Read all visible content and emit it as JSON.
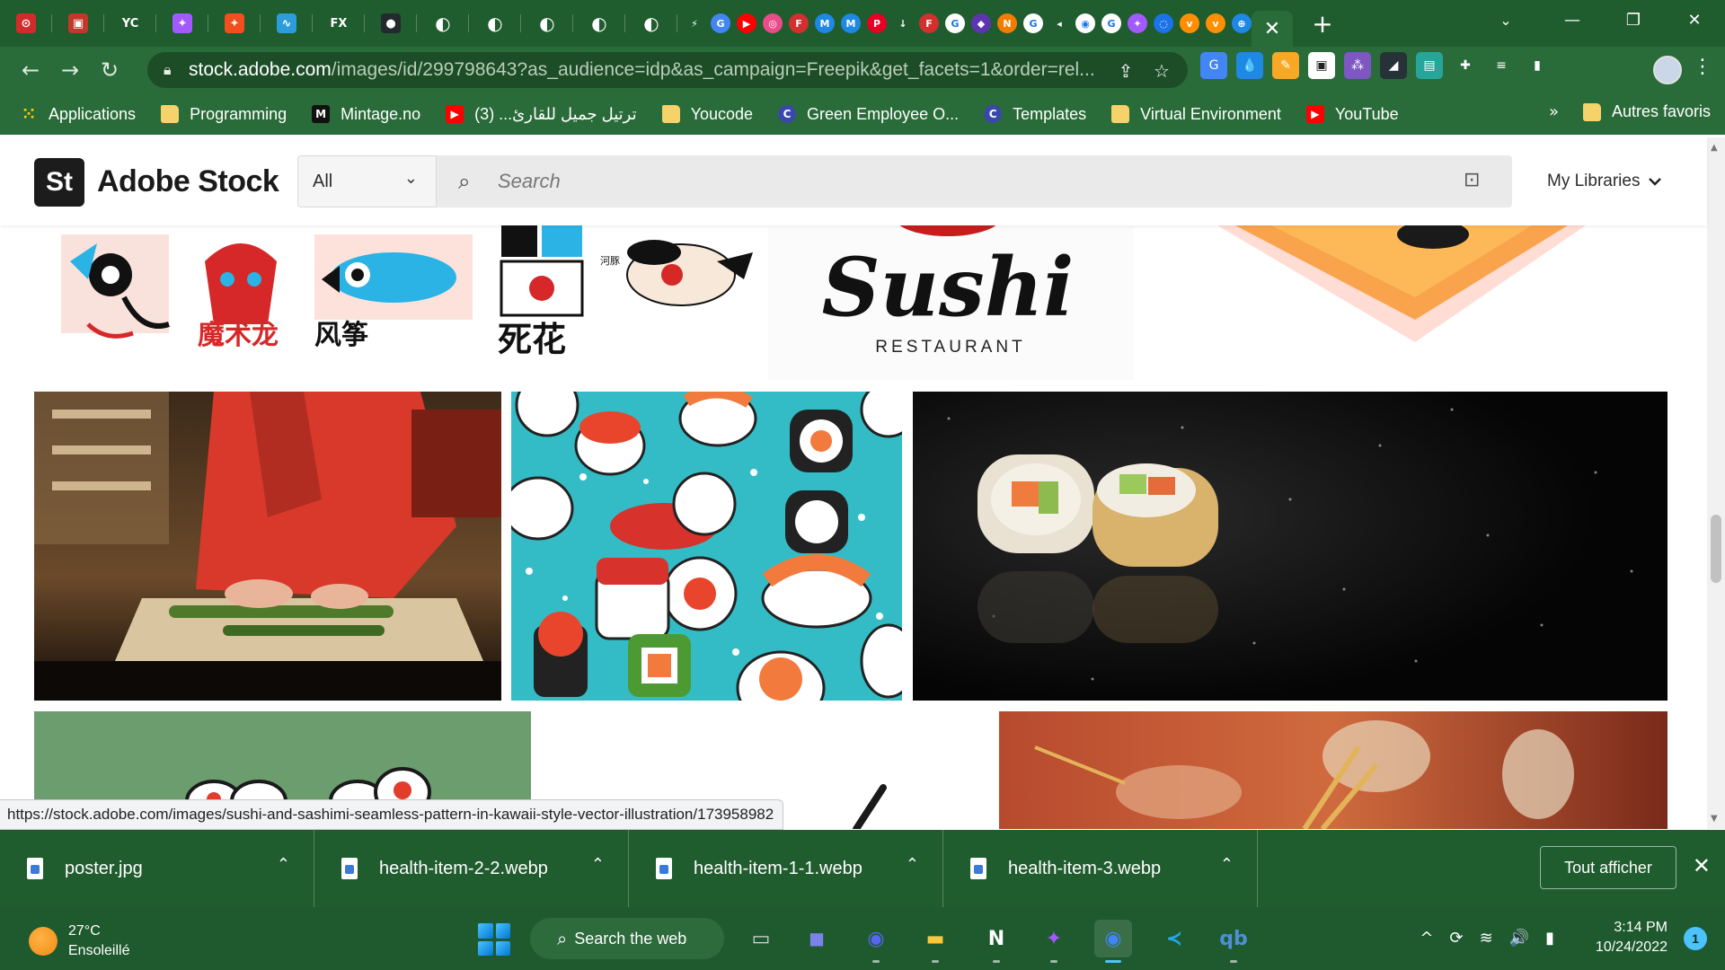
{
  "browser": {
    "pinned_tabs": [
      {
        "icon": "opera-icon",
        "color": "#d32b2b",
        "glyph": "⊙"
      },
      {
        "icon": "chrome-ext-icon",
        "color": "#c0392b",
        "glyph": "▣"
      },
      {
        "icon": "yc-icon",
        "color": "#1f5c2e",
        "glyph": "YC"
      },
      {
        "icon": "figma-icon",
        "color": "#a259ff",
        "glyph": "✦"
      },
      {
        "icon": "figma-icon",
        "color": "#f24e1e",
        "glyph": "✦"
      },
      {
        "icon": "notion-sync-icon",
        "color": "#2d9cdb",
        "glyph": "∿"
      },
      {
        "icon": "fx-icon",
        "color": "#1f5c2e",
        "glyph": "FX"
      },
      {
        "icon": "github-icon",
        "color": "#24292e",
        "glyph": "●"
      },
      {
        "icon": "site-icon",
        "color": "#ffffff",
        "glyph": "◐"
      },
      {
        "icon": "site-icon",
        "color": "#ffffff",
        "glyph": "◐"
      },
      {
        "icon": "site-icon",
        "color": "#ffffff",
        "glyph": "◐"
      },
      {
        "icon": "site-icon",
        "color": "#ffffff",
        "glyph": "◐"
      },
      {
        "icon": "site-icon",
        "color": "#ffffff",
        "glyph": "◐"
      }
    ],
    "mini_tabs": [
      {
        "icon": "lightning-icon",
        "color": "#1f5c2e",
        "glyph": "⚡"
      },
      {
        "icon": "translate-icon",
        "color": "#4285f4",
        "glyph": "G"
      },
      {
        "icon": "youtube-icon",
        "color": "#ff0000",
        "glyph": "▶"
      },
      {
        "icon": "dribbble-icon",
        "color": "#ea4c89",
        "glyph": "◎"
      },
      {
        "icon": "f-icon",
        "color": "#d32f2f",
        "glyph": "F"
      },
      {
        "icon": "mw-icon",
        "color": "#1e88e5",
        "glyph": "M"
      },
      {
        "icon": "mw-icon",
        "color": "#1e88e5",
        "glyph": "M"
      },
      {
        "icon": "pinterest-icon",
        "color": "#e60023",
        "glyph": "P"
      },
      {
        "icon": "download-icon",
        "color": "#1f5c2e",
        "glyph": "↓"
      },
      {
        "icon": "f-icon",
        "color": "#d32f2f",
        "glyph": "F"
      },
      {
        "icon": "google-icon",
        "color": "#ffffff",
        "glyph": "G"
      },
      {
        "icon": "gem-icon",
        "color": "#5e35b1",
        "glyph": "◆"
      },
      {
        "icon": "nx-icon",
        "color": "#f57c00",
        "glyph": "N"
      },
      {
        "icon": "google-icon",
        "color": "#ffffff",
        "glyph": "G"
      },
      {
        "icon": "sound-icon",
        "color": "#1f5c2e",
        "glyph": "◂"
      },
      {
        "icon": "chrome-icon",
        "color": "#ffffff",
        "glyph": "◉"
      },
      {
        "icon": "google-icon",
        "color": "#ffffff",
        "glyph": "G"
      },
      {
        "icon": "figma-icon",
        "color": "#a259ff",
        "glyph": "✦"
      },
      {
        "icon": "ring-icon",
        "color": "#1a73e8",
        "glyph": "◌"
      },
      {
        "icon": "v-icon",
        "color": "#ff8f00",
        "glyph": "v"
      },
      {
        "icon": "v-icon",
        "color": "#ff8f00",
        "glyph": "v"
      },
      {
        "icon": "globe-icon",
        "color": "#1e88e5",
        "glyph": "⊕"
      }
    ],
    "active_tab_close": "✕",
    "new_tab": "+",
    "tab_search": "⌄",
    "window": {
      "minimize": "—",
      "restore": "❐",
      "close": "✕"
    }
  },
  "toolbar": {
    "back": "←",
    "forward": "→",
    "reload": "↻",
    "url_host": "stock.adobe.com",
    "url_path": "/images/id/299798643?as_audience=idp&as_campaign=Freepik&get_facets=1&order=rel...",
    "share": "⇪",
    "star": "☆",
    "extensions": [
      {
        "icon": "translate-ext-icon",
        "color": "#4285f4",
        "glyph": "G"
      },
      {
        "icon": "drop-ext-icon",
        "color": "#1e88e5",
        "glyph": "💧"
      },
      {
        "icon": "edit-ext-icon",
        "color": "#f9a825",
        "glyph": "✎"
      },
      {
        "icon": "pip-ext-icon",
        "color": "#ffffff",
        "glyph": "▣"
      },
      {
        "icon": "grid-ext-icon",
        "color": "#7e57c2",
        "glyph": "⁂"
      },
      {
        "icon": "dark-ext-icon",
        "color": "#263238",
        "glyph": "◢"
      },
      {
        "icon": "radio-ext-icon",
        "color": "#26a69a",
        "glyph": "▤"
      },
      {
        "icon": "puzzle-icon",
        "color": "#2a6b3a",
        "glyph": "✚"
      },
      {
        "icon": "media-icon",
        "color": "#2a6b3a",
        "glyph": "≡"
      },
      {
        "icon": "sidepanel-icon",
        "color": "#2a6b3a",
        "glyph": "▮"
      }
    ],
    "menu": "⋮"
  },
  "bookmarks": {
    "items": [
      {
        "label": "Applications",
        "icon": "apps-grid-icon",
        "color": "#e53935",
        "glyph": "⁙"
      },
      {
        "label": "Programming",
        "icon": "folder-icon",
        "color": "#f5d36a",
        "glyph": ""
      },
      {
        "label": "Mintage.no",
        "icon": "mintage-icon",
        "color": "#111111",
        "glyph": "M"
      },
      {
        "label": "ترتيل جميل للقارئ... (3)",
        "icon": "youtube-icon",
        "color": "#ff0000",
        "glyph": "▶"
      },
      {
        "label": "Youcode",
        "icon": "folder-icon",
        "color": "#f5d36a",
        "glyph": ""
      },
      {
        "label": "Green Employee O...",
        "icon": "c-circle-icon",
        "color": "#3949ab",
        "glyph": "C"
      },
      {
        "label": "Templates",
        "icon": "c-circle-icon",
        "color": "#3949ab",
        "glyph": "C"
      },
      {
        "label": "Virtual Environment",
        "icon": "folder-icon",
        "color": "#f5d36a",
        "glyph": ""
      },
      {
        "label": "YouTube",
        "icon": "youtube-icon",
        "color": "#ff0000",
        "glyph": "▶"
      }
    ],
    "more": "»",
    "other": "Autres favoris"
  },
  "stock": {
    "logo": "St",
    "brand": "Adobe Stock",
    "filter_value": "All",
    "search_placeholder": "Search",
    "libraries": "My Libraries",
    "hover_url": "https://stock.adobe.com/images/sushi-and-sashimi-seamless-pattern-in-kawaii-style-vector-illustration/173958982",
    "thumbnails": [
      {
        "kind": "japanese-illustrations",
        "captions": [
          "魔术龙",
          "风筝",
          "死花",
          "河豚"
        ]
      },
      {
        "kind": "sushi-logo",
        "title": "Sushi",
        "subtitle": "RESTAURANT"
      },
      {
        "kind": "sushi-board"
      },
      {
        "kind": "sushi-chef-photo"
      },
      {
        "kind": "kawaii-sushi-pattern"
      },
      {
        "kind": "sushi-rolls-dark"
      },
      {
        "kind": "green-sushi-illustration"
      },
      {
        "kind": "chopsticks-white"
      },
      {
        "kind": "dinner-wine-photo"
      }
    ]
  },
  "downloads": {
    "items": [
      "poster.jpg",
      "health-item-2-2.webp",
      "health-item-1-1.webp",
      "health-item-3.webp"
    ],
    "show_all": "Tout afficher",
    "close": "✕"
  },
  "taskbar": {
    "weather_temp": "27°C",
    "weather_desc": "Ensoleillé",
    "search_label": "Search the web",
    "apps": [
      {
        "name": "task-view-icon",
        "color": "#cfd8dc",
        "glyph": "▭"
      },
      {
        "name": "teams-chat-icon",
        "color": "#7b83eb",
        "glyph": "◼"
      },
      {
        "name": "discord-icon",
        "color": "#5865f2",
        "glyph": "◉"
      },
      {
        "name": "file-explorer-icon",
        "color": "#f9c73c",
        "glyph": "▬"
      },
      {
        "name": "notion-icon",
        "color": "#ffffff",
        "glyph": "N"
      },
      {
        "name": "figma-icon",
        "color": "#a259ff",
        "glyph": "✦"
      },
      {
        "name": "chrome-icon",
        "color": "#4285f4",
        "glyph": "◉"
      },
      {
        "name": "vscode-icon",
        "color": "#23a9f2",
        "glyph": "≺"
      },
      {
        "name": "qbittorrent-icon",
        "color": "#4f8fd8",
        "glyph": "qb"
      }
    ],
    "tray": [
      "^",
      "⟳",
      "≋",
      "🔊",
      "▮"
    ],
    "time": "3:14 PM",
    "date": "10/24/2022",
    "notifications": "1"
  }
}
